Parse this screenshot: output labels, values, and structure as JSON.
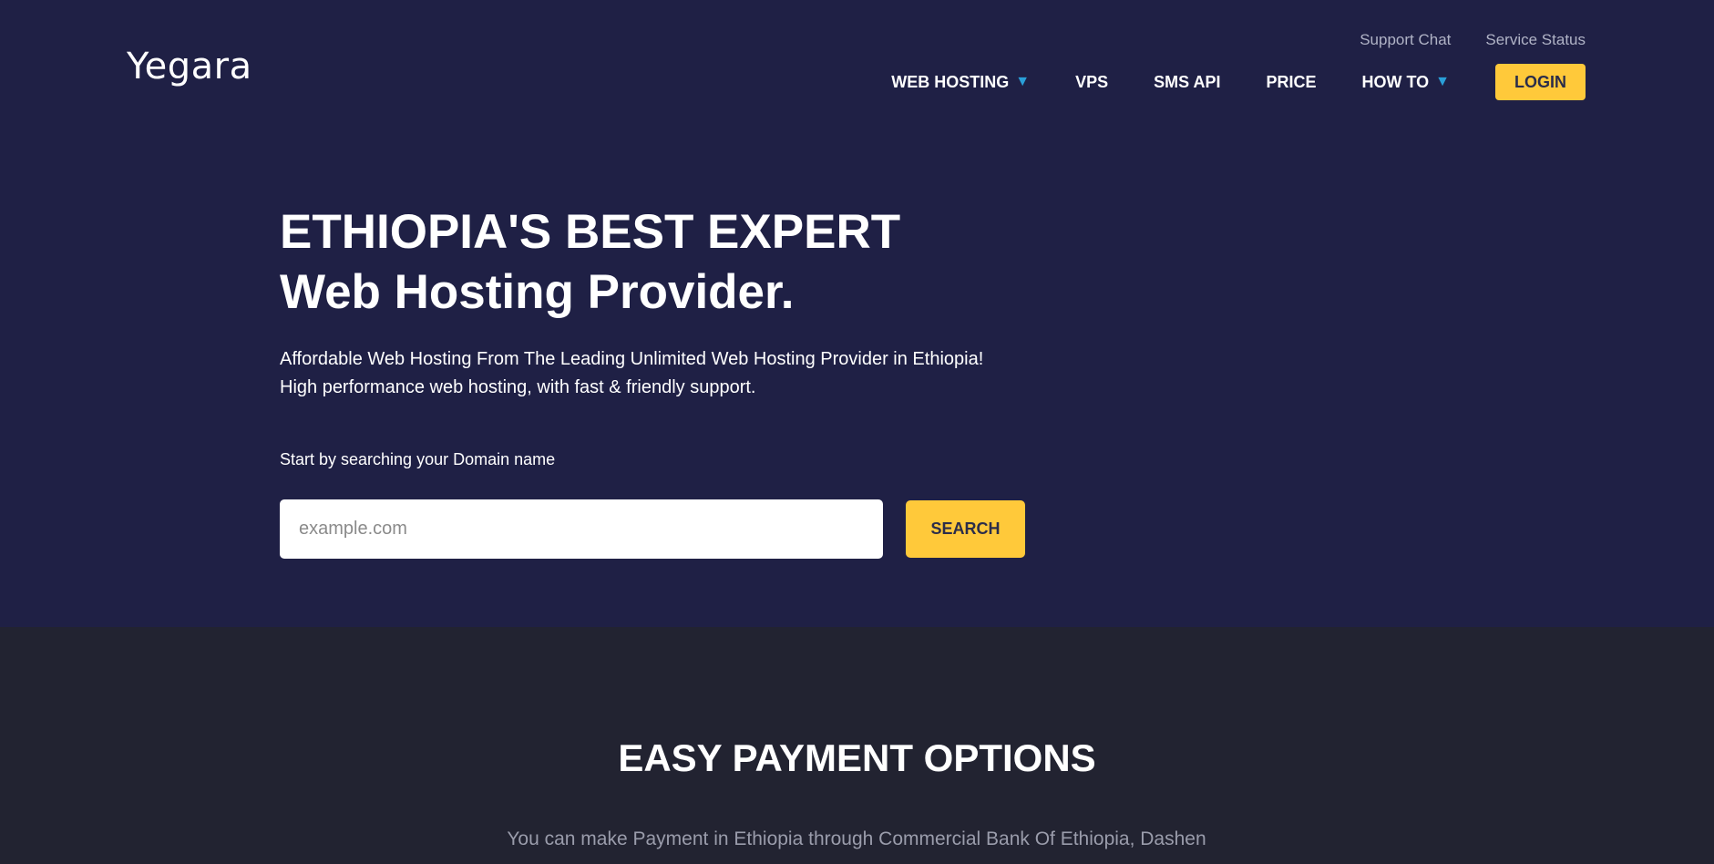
{
  "header": {
    "logo": "Yegara",
    "top_links": [
      "Support Chat",
      "Service Status"
    ],
    "nav": {
      "web_hosting": "WEB HOSTING",
      "vps": "VPS",
      "sms_api": "SMS API",
      "price": "PRICE",
      "how_to": "HOW TO",
      "login": "LOGIN",
      "caret": "▼"
    }
  },
  "hero": {
    "headline_line1": "ETHIOPIA'S BEST EXPERT",
    "headline_line2": "Web Hosting Provider.",
    "subtext": "Affordable Web Hosting From The Leading Unlimited Web Hosting Provider in Ethiopia! High performance web hosting, with fast & friendly support.",
    "search_label": "Start by searching your Domain name",
    "search_placeholder": "example.com",
    "search_button": "SEARCH"
  },
  "payment": {
    "title": "EASY PAYMENT OPTIONS",
    "desc": "You can make Payment in Ethiopia through Commercial Bank Of Ethiopia, Dashen"
  },
  "colors": {
    "hero_bg": "#1f2045",
    "section_bg": "#222331",
    "accent_yellow": "#ffc93a",
    "caret_blue": "#2a9fd8"
  }
}
